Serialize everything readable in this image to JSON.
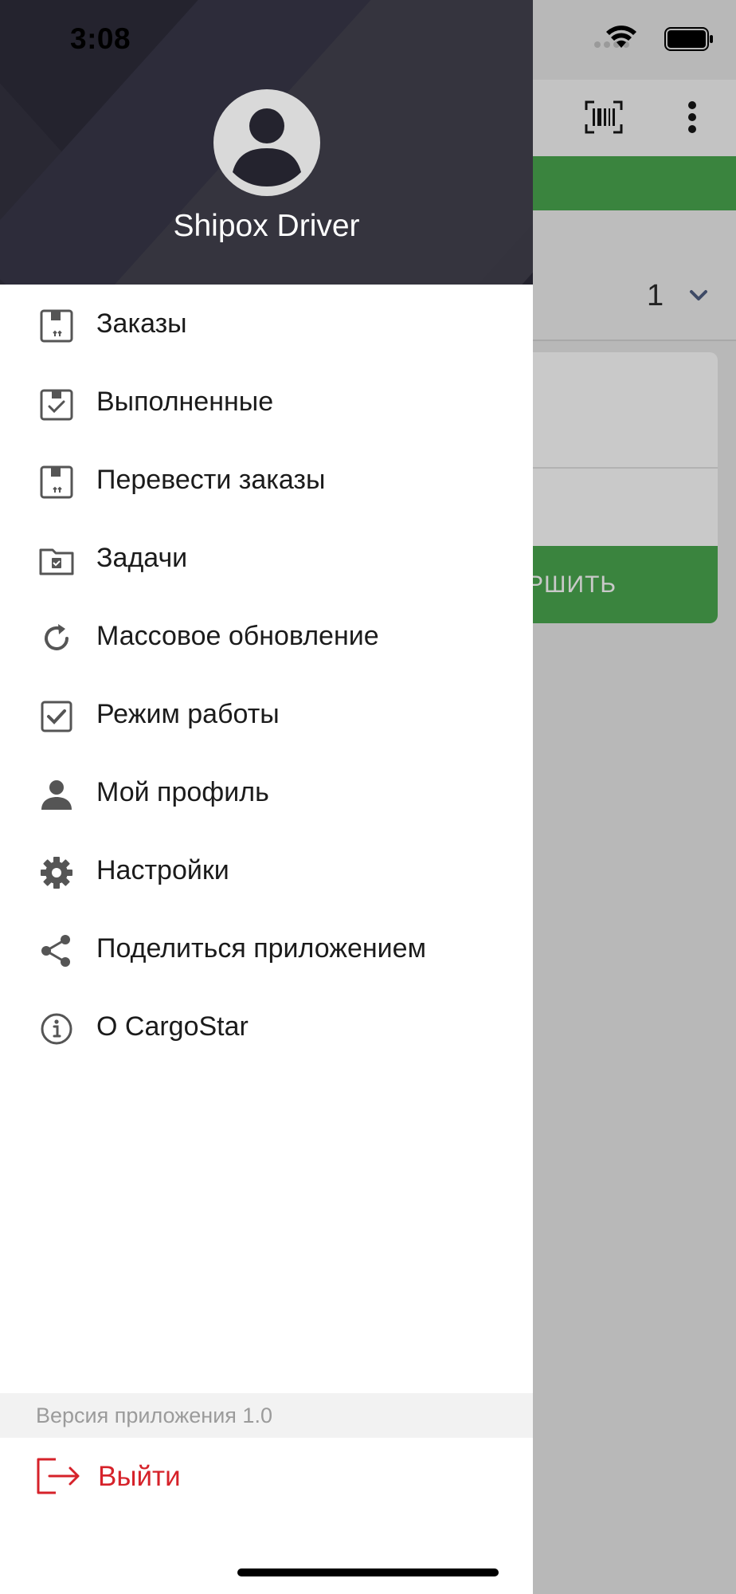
{
  "status": {
    "time": "3:08"
  },
  "drawer": {
    "user_name": "Shipox Driver",
    "menu": [
      {
        "label": "Заказы",
        "icon": "box-in-icon"
      },
      {
        "label": "Выполненные",
        "icon": "box-check-icon"
      },
      {
        "label": "Перевести заказы",
        "icon": "box-transfer-icon"
      },
      {
        "label": "Задачи",
        "icon": "folder-task-icon"
      },
      {
        "label": "Массовое обновление",
        "icon": "refresh-icon"
      },
      {
        "label": "Режим работы",
        "icon": "checkbox-icon"
      },
      {
        "label": "Мой профиль",
        "icon": "person-icon"
      },
      {
        "label": "Настройки",
        "icon": "gear-icon"
      },
      {
        "label": "Поделиться приложением",
        "icon": "share-icon"
      },
      {
        "label": "О CargoStar",
        "icon": "info-icon"
      }
    ],
    "version_label": "Версия приложения 1.0",
    "logout_label": "Выйти"
  },
  "background": {
    "selector_value": "1",
    "button_label_partial": "РШИТЬ"
  },
  "colors": {
    "header_dark": "#24232e",
    "accent_green": "#3a843e",
    "logout_red": "#d6222a",
    "icon_gray": "#555555"
  }
}
